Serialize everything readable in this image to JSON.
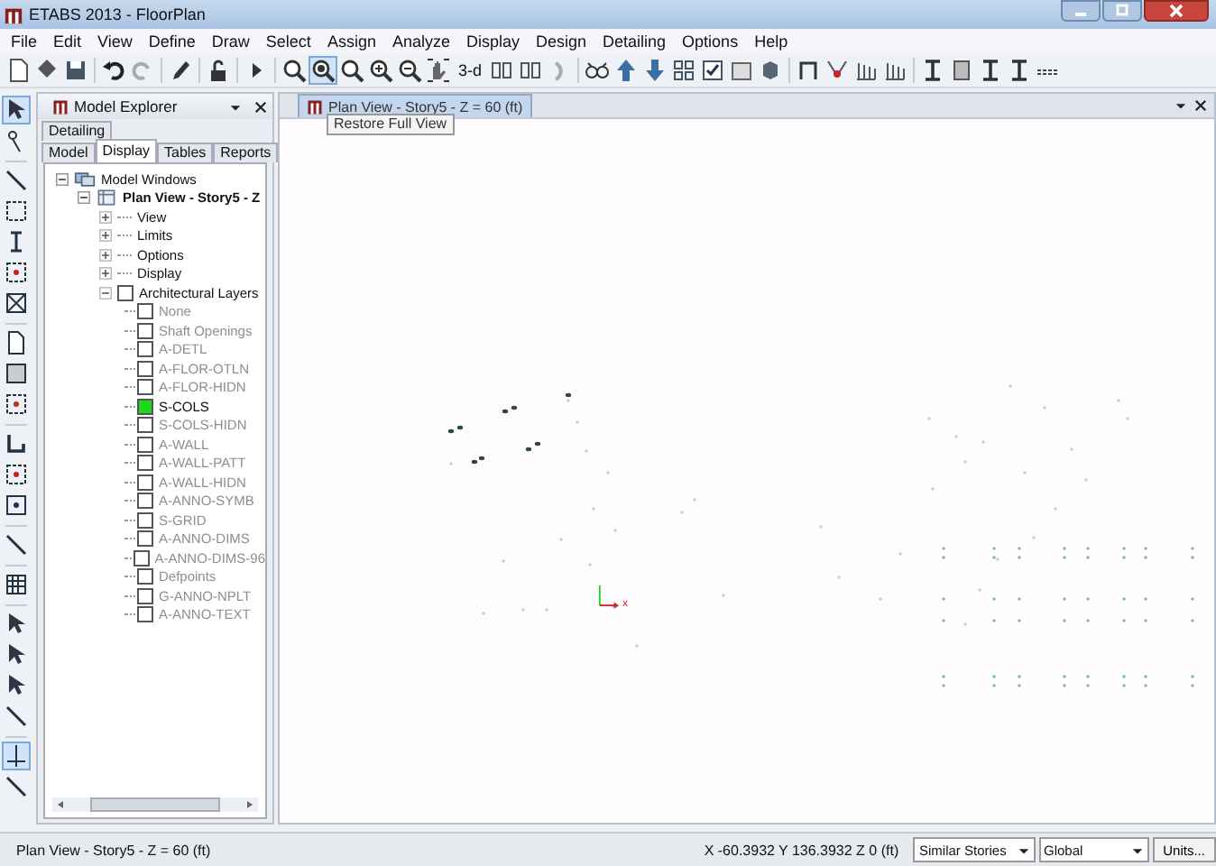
{
  "window": {
    "title": "ETABS 2013  - FloorPlan"
  },
  "menu": [
    "File",
    "Edit",
    "View",
    "Define",
    "Draw",
    "Select",
    "Assign",
    "Analyze",
    "Display",
    "Design",
    "Detailing",
    "Options",
    "Help"
  ],
  "toolbar": {
    "view_3d": "3-d",
    "tooltip": "Restore Full View"
  },
  "explorer": {
    "title": "Model Explorer",
    "tab_rows": [
      {
        "tabs": [
          {
            "label": "Detailing",
            "selected": false
          }
        ]
      },
      {
        "tabs": [
          {
            "label": "Model",
            "selected": false
          },
          {
            "label": "Display",
            "selected": true
          },
          {
            "label": "Tables",
            "selected": false
          },
          {
            "label": "Reports",
            "selected": false
          }
        ]
      }
    ],
    "root": "Model Windows",
    "view": "Plan View - Story5 - Z",
    "nodes": [
      {
        "label": "View",
        "expanded": false
      },
      {
        "label": "Limits",
        "expanded": false
      },
      {
        "label": "Options",
        "expanded": false
      },
      {
        "label": "Display",
        "expanded": false
      }
    ],
    "layers_group": {
      "label": "Architectural Layers",
      "expanded": true,
      "checked": false
    },
    "layers": [
      {
        "name": "None",
        "checked": false,
        "dimmed": true
      },
      {
        "name": "Shaft Openings",
        "checked": false,
        "dimmed": true
      },
      {
        "name": "A-DETL",
        "checked": false,
        "dimmed": true
      },
      {
        "name": "A-FLOR-OTLN",
        "checked": false,
        "dimmed": true
      },
      {
        "name": "A-FLOR-HIDN",
        "checked": false,
        "dimmed": true
      },
      {
        "name": "S-COLS",
        "checked": true,
        "dimmed": false
      },
      {
        "name": "S-COLS-HIDN",
        "checked": false,
        "dimmed": true
      },
      {
        "name": "A-WALL",
        "checked": false,
        "dimmed": true
      },
      {
        "name": "A-WALL-PATT",
        "checked": false,
        "dimmed": true
      },
      {
        "name": "A-WALL-HIDN",
        "checked": false,
        "dimmed": true
      },
      {
        "name": "A-ANNO-SYMB",
        "checked": false,
        "dimmed": true
      },
      {
        "name": "S-GRID",
        "checked": false,
        "dimmed": true
      },
      {
        "name": "A-ANNO-DIMS",
        "checked": false,
        "dimmed": true
      },
      {
        "name": "A-ANNO-DIMS-96",
        "checked": false,
        "dimmed": true
      },
      {
        "name": "Defpoints",
        "checked": false,
        "dimmed": true
      },
      {
        "name": "G-ANNO-NPLT",
        "checked": false,
        "dimmed": true
      },
      {
        "name": "A-ANNO-TEXT",
        "checked": false,
        "dimmed": true
      }
    ]
  },
  "plan_view": {
    "tab": "Plan View - Story5 - Z = 60 (ft)",
    "axis_label": "x"
  },
  "status_bar": {
    "view": "Plan View - Story5 - Z = 60 (ft)",
    "coordinates": "X -60.3932  Y 136.3932  Z 0 (ft)",
    "stories": "Similar Stories",
    "coord_system": "Global",
    "units": "Units..."
  }
}
